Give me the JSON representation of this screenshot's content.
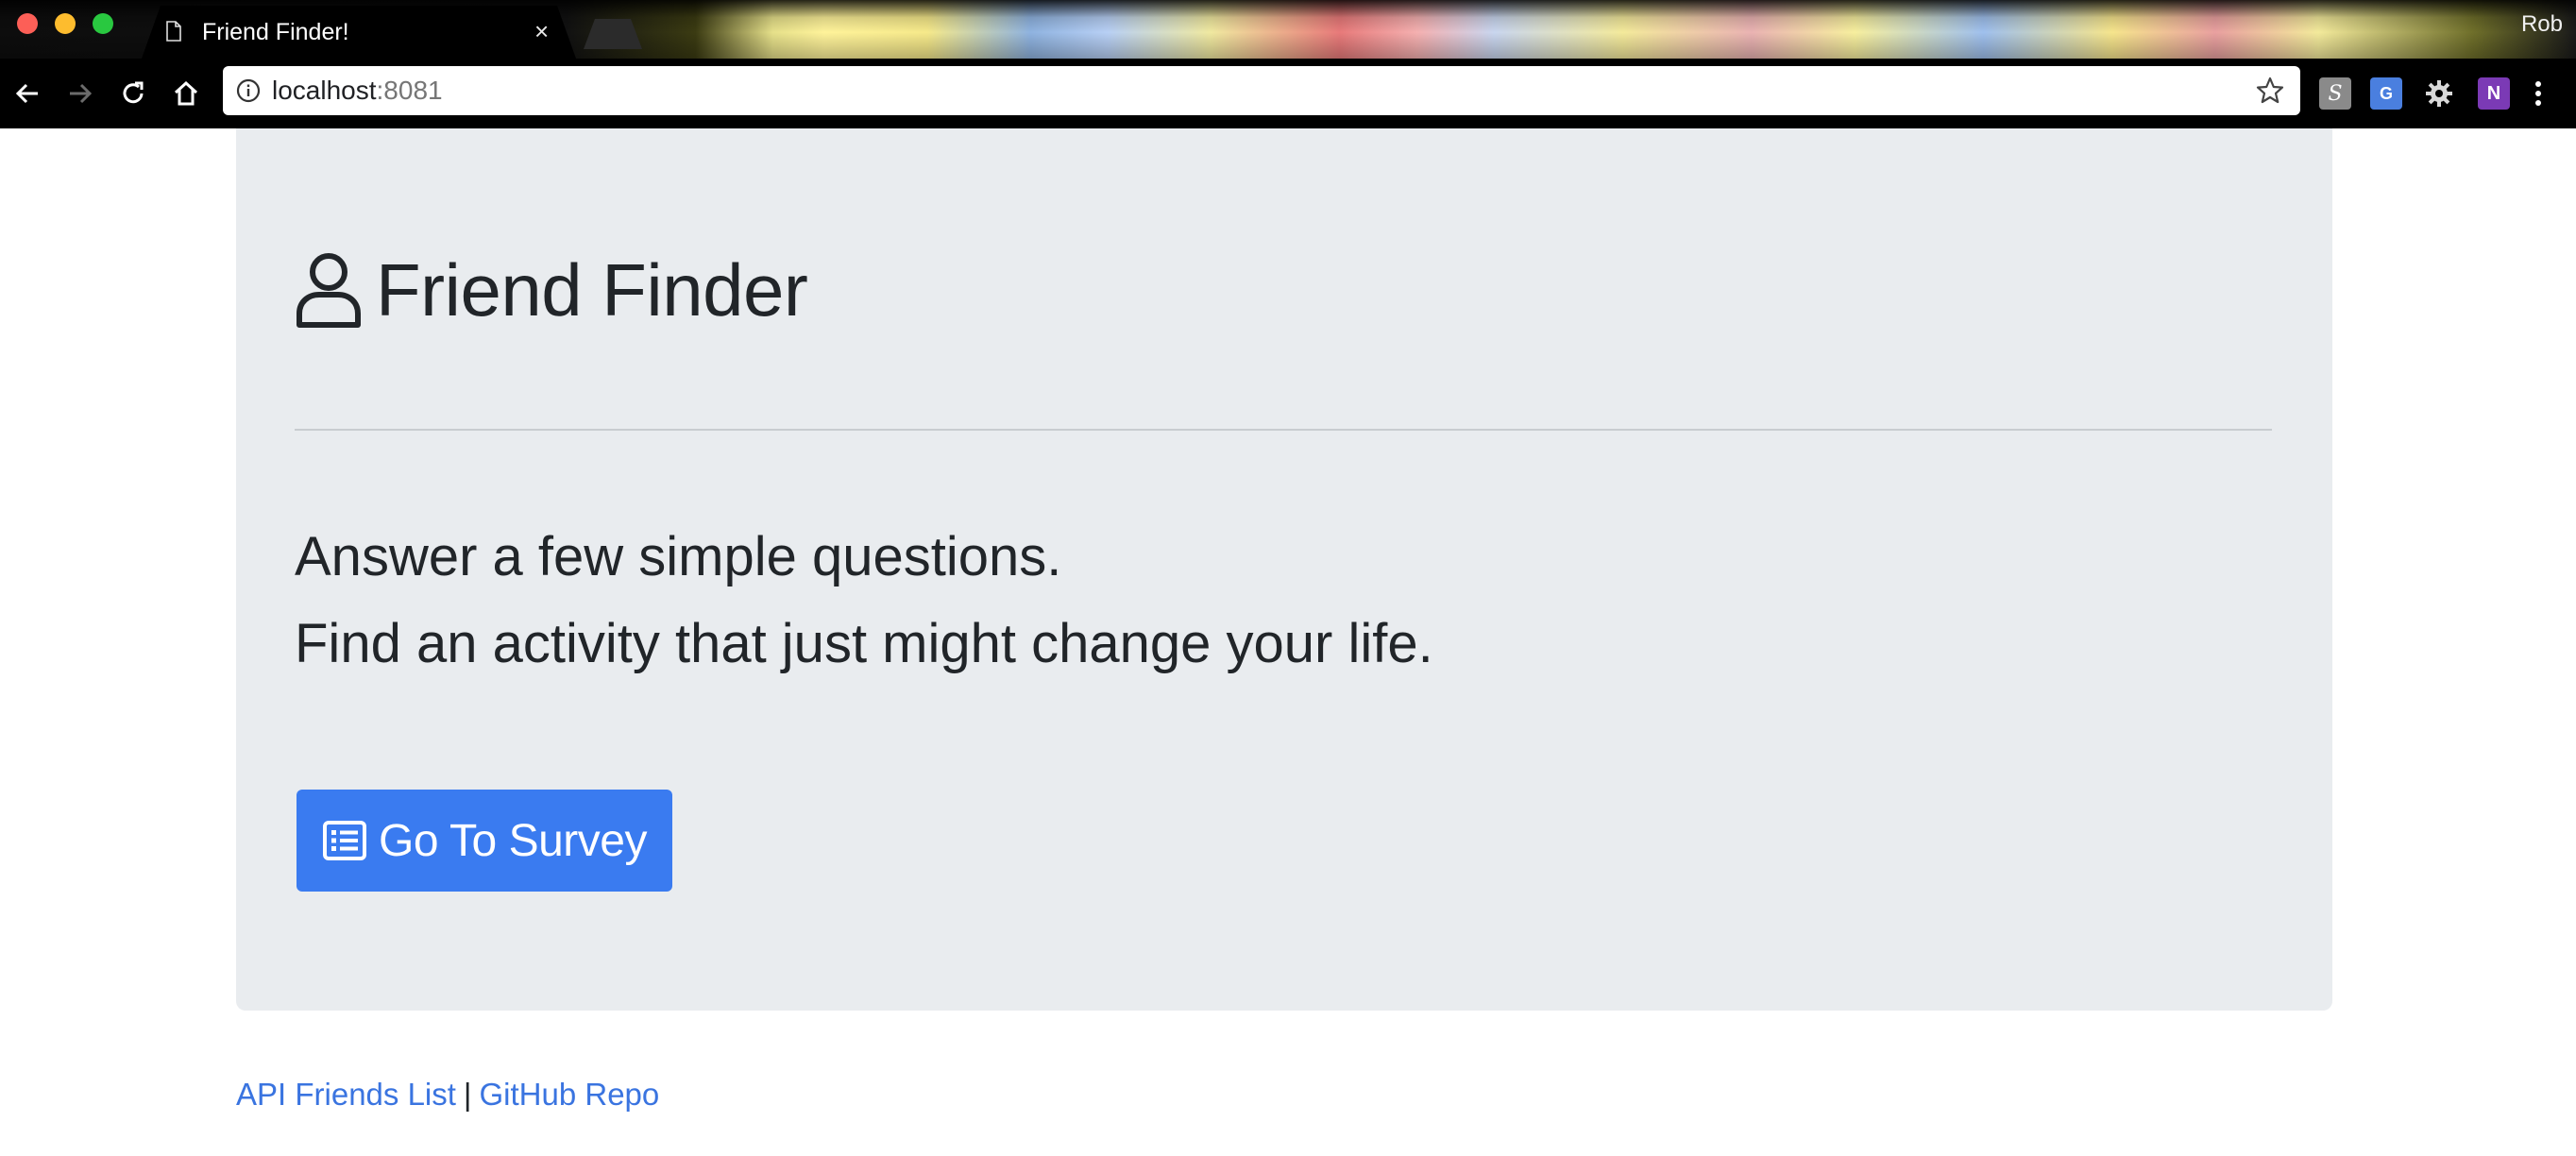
{
  "browser": {
    "tab_title": "Friend Finder!",
    "tab_close": "×",
    "profile_name": "Rob",
    "url_host": "localhost",
    "url_port": ":8081",
    "extensions": {
      "s": "S",
      "translate": "G",
      "onenote": "N"
    }
  },
  "page": {
    "title": "Friend Finder",
    "lead_line_1": "Answer a few simple questions.",
    "lead_line_2": "Find an activity that just might change your life.",
    "survey_button": "Go To Survey"
  },
  "footer": {
    "api_link": "API Friends List",
    "separator": "|",
    "github_link": "GitHub Repo"
  },
  "colors": {
    "jumbotron_bg": "#e9ecef",
    "primary_button": "#3a7bf0",
    "link": "#3a74e0",
    "text": "#212529"
  }
}
